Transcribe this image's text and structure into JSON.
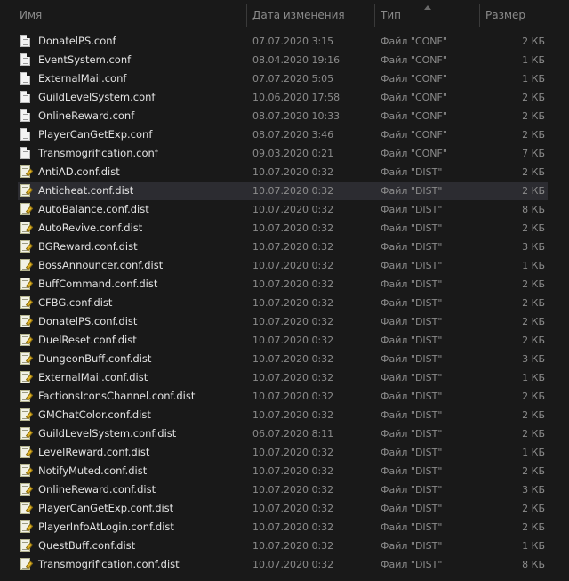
{
  "header": {
    "name": "Имя",
    "date": "Дата изменения",
    "type": "Тип",
    "size": "Размер"
  },
  "files": [
    {
      "name": "DonatelPS.conf",
      "date": "07.07.2020 3:15",
      "type": "Файл \"CONF\"",
      "size": "2 КБ",
      "icon": "text-file-icon"
    },
    {
      "name": "EventSystem.conf",
      "date": "08.04.2020 19:16",
      "type": "Файл \"CONF\"",
      "size": "1 КБ",
      "icon": "text-file-icon"
    },
    {
      "name": "ExternalMail.conf",
      "date": "07.07.2020 5:05",
      "type": "Файл \"CONF\"",
      "size": "1 КБ",
      "icon": "text-file-icon"
    },
    {
      "name": "GuildLevelSystem.conf",
      "date": "10.06.2020 17:58",
      "type": "Файл \"CONF\"",
      "size": "2 КБ",
      "icon": "text-file-icon"
    },
    {
      "name": "OnlineReward.conf",
      "date": "08.07.2020 10:33",
      "type": "Файл \"CONF\"",
      "size": "2 КБ",
      "icon": "text-file-icon"
    },
    {
      "name": "PlayerCanGetExp.conf",
      "date": "08.07.2020 3:46",
      "type": "Файл \"CONF\"",
      "size": "2 КБ",
      "icon": "text-file-icon"
    },
    {
      "name": "Transmogrification.conf",
      "date": "09.03.2020 0:21",
      "type": "Файл \"CONF\"",
      "size": "7 КБ",
      "icon": "text-file-icon"
    },
    {
      "name": "AntiAD.conf.dist",
      "date": "10.07.2020 0:32",
      "type": "Файл \"DIST\"",
      "size": "2 КБ",
      "icon": "edit-file-icon"
    },
    {
      "name": "Anticheat.conf.dist",
      "date": "10.07.2020 0:32",
      "type": "Файл \"DIST\"",
      "size": "2 КБ",
      "icon": "edit-file-icon",
      "selected": true
    },
    {
      "name": "AutoBalance.conf.dist",
      "date": "10.07.2020 0:32",
      "type": "Файл \"DIST\"",
      "size": "8 КБ",
      "icon": "edit-file-icon"
    },
    {
      "name": "AutoRevive.conf.dist",
      "date": "10.07.2020 0:32",
      "type": "Файл \"DIST\"",
      "size": "2 КБ",
      "icon": "edit-file-icon"
    },
    {
      "name": "BGReward.conf.dist",
      "date": "10.07.2020 0:32",
      "type": "Файл \"DIST\"",
      "size": "3 КБ",
      "icon": "edit-file-icon"
    },
    {
      "name": "BossAnnouncer.conf.dist",
      "date": "10.07.2020 0:32",
      "type": "Файл \"DIST\"",
      "size": "1 КБ",
      "icon": "edit-file-icon"
    },
    {
      "name": "BuffCommand.conf.dist",
      "date": "10.07.2020 0:32",
      "type": "Файл \"DIST\"",
      "size": "2 КБ",
      "icon": "edit-file-icon"
    },
    {
      "name": "CFBG.conf.dist",
      "date": "10.07.2020 0:32",
      "type": "Файл \"DIST\"",
      "size": "2 КБ",
      "icon": "edit-file-icon"
    },
    {
      "name": "DonatelPS.conf.dist",
      "date": "10.07.2020 0:32",
      "type": "Файл \"DIST\"",
      "size": "2 КБ",
      "icon": "edit-file-icon"
    },
    {
      "name": "DuelReset.conf.dist",
      "date": "10.07.2020 0:32",
      "type": "Файл \"DIST\"",
      "size": "2 КБ",
      "icon": "edit-file-icon"
    },
    {
      "name": "DungeonBuff.conf.dist",
      "date": "10.07.2020 0:32",
      "type": "Файл \"DIST\"",
      "size": "3 КБ",
      "icon": "edit-file-icon"
    },
    {
      "name": "ExternalMail.conf.dist",
      "date": "10.07.2020 0:32",
      "type": "Файл \"DIST\"",
      "size": "1 КБ",
      "icon": "edit-file-icon"
    },
    {
      "name": "FactionsIconsChannel.conf.dist",
      "date": "10.07.2020 0:32",
      "type": "Файл \"DIST\"",
      "size": "2 КБ",
      "icon": "edit-file-icon"
    },
    {
      "name": "GMChatColor.conf.dist",
      "date": "10.07.2020 0:32",
      "type": "Файл \"DIST\"",
      "size": "2 КБ",
      "icon": "edit-file-icon"
    },
    {
      "name": "GuildLevelSystem.conf.dist",
      "date": "06.07.2020 8:11",
      "type": "Файл \"DIST\"",
      "size": "2 КБ",
      "icon": "edit-file-icon"
    },
    {
      "name": "LevelReward.conf.dist",
      "date": "10.07.2020 0:32",
      "type": "Файл \"DIST\"",
      "size": "1 КБ",
      "icon": "edit-file-icon"
    },
    {
      "name": "NotifyMuted.conf.dist",
      "date": "10.07.2020 0:32",
      "type": "Файл \"DIST\"",
      "size": "2 КБ",
      "icon": "edit-file-icon"
    },
    {
      "name": "OnlineReward.conf.dist",
      "date": "10.07.2020 0:32",
      "type": "Файл \"DIST\"",
      "size": "3 КБ",
      "icon": "edit-file-icon"
    },
    {
      "name": "PlayerCanGetExp.conf.dist",
      "date": "10.07.2020 0:32",
      "type": "Файл \"DIST\"",
      "size": "2 КБ",
      "icon": "edit-file-icon"
    },
    {
      "name": "PlayerInfoAtLogin.conf.dist",
      "date": "10.07.2020 0:32",
      "type": "Файл \"DIST\"",
      "size": "2 КБ",
      "icon": "edit-file-icon"
    },
    {
      "name": "QuestBuff.conf.dist",
      "date": "10.07.2020 0:32",
      "type": "Файл \"DIST\"",
      "size": "1 КБ",
      "icon": "edit-file-icon"
    },
    {
      "name": "Transmogrification.conf.dist",
      "date": "10.07.2020 0:32",
      "type": "Файл \"DIST\"",
      "size": "8 КБ",
      "icon": "edit-file-icon"
    }
  ]
}
